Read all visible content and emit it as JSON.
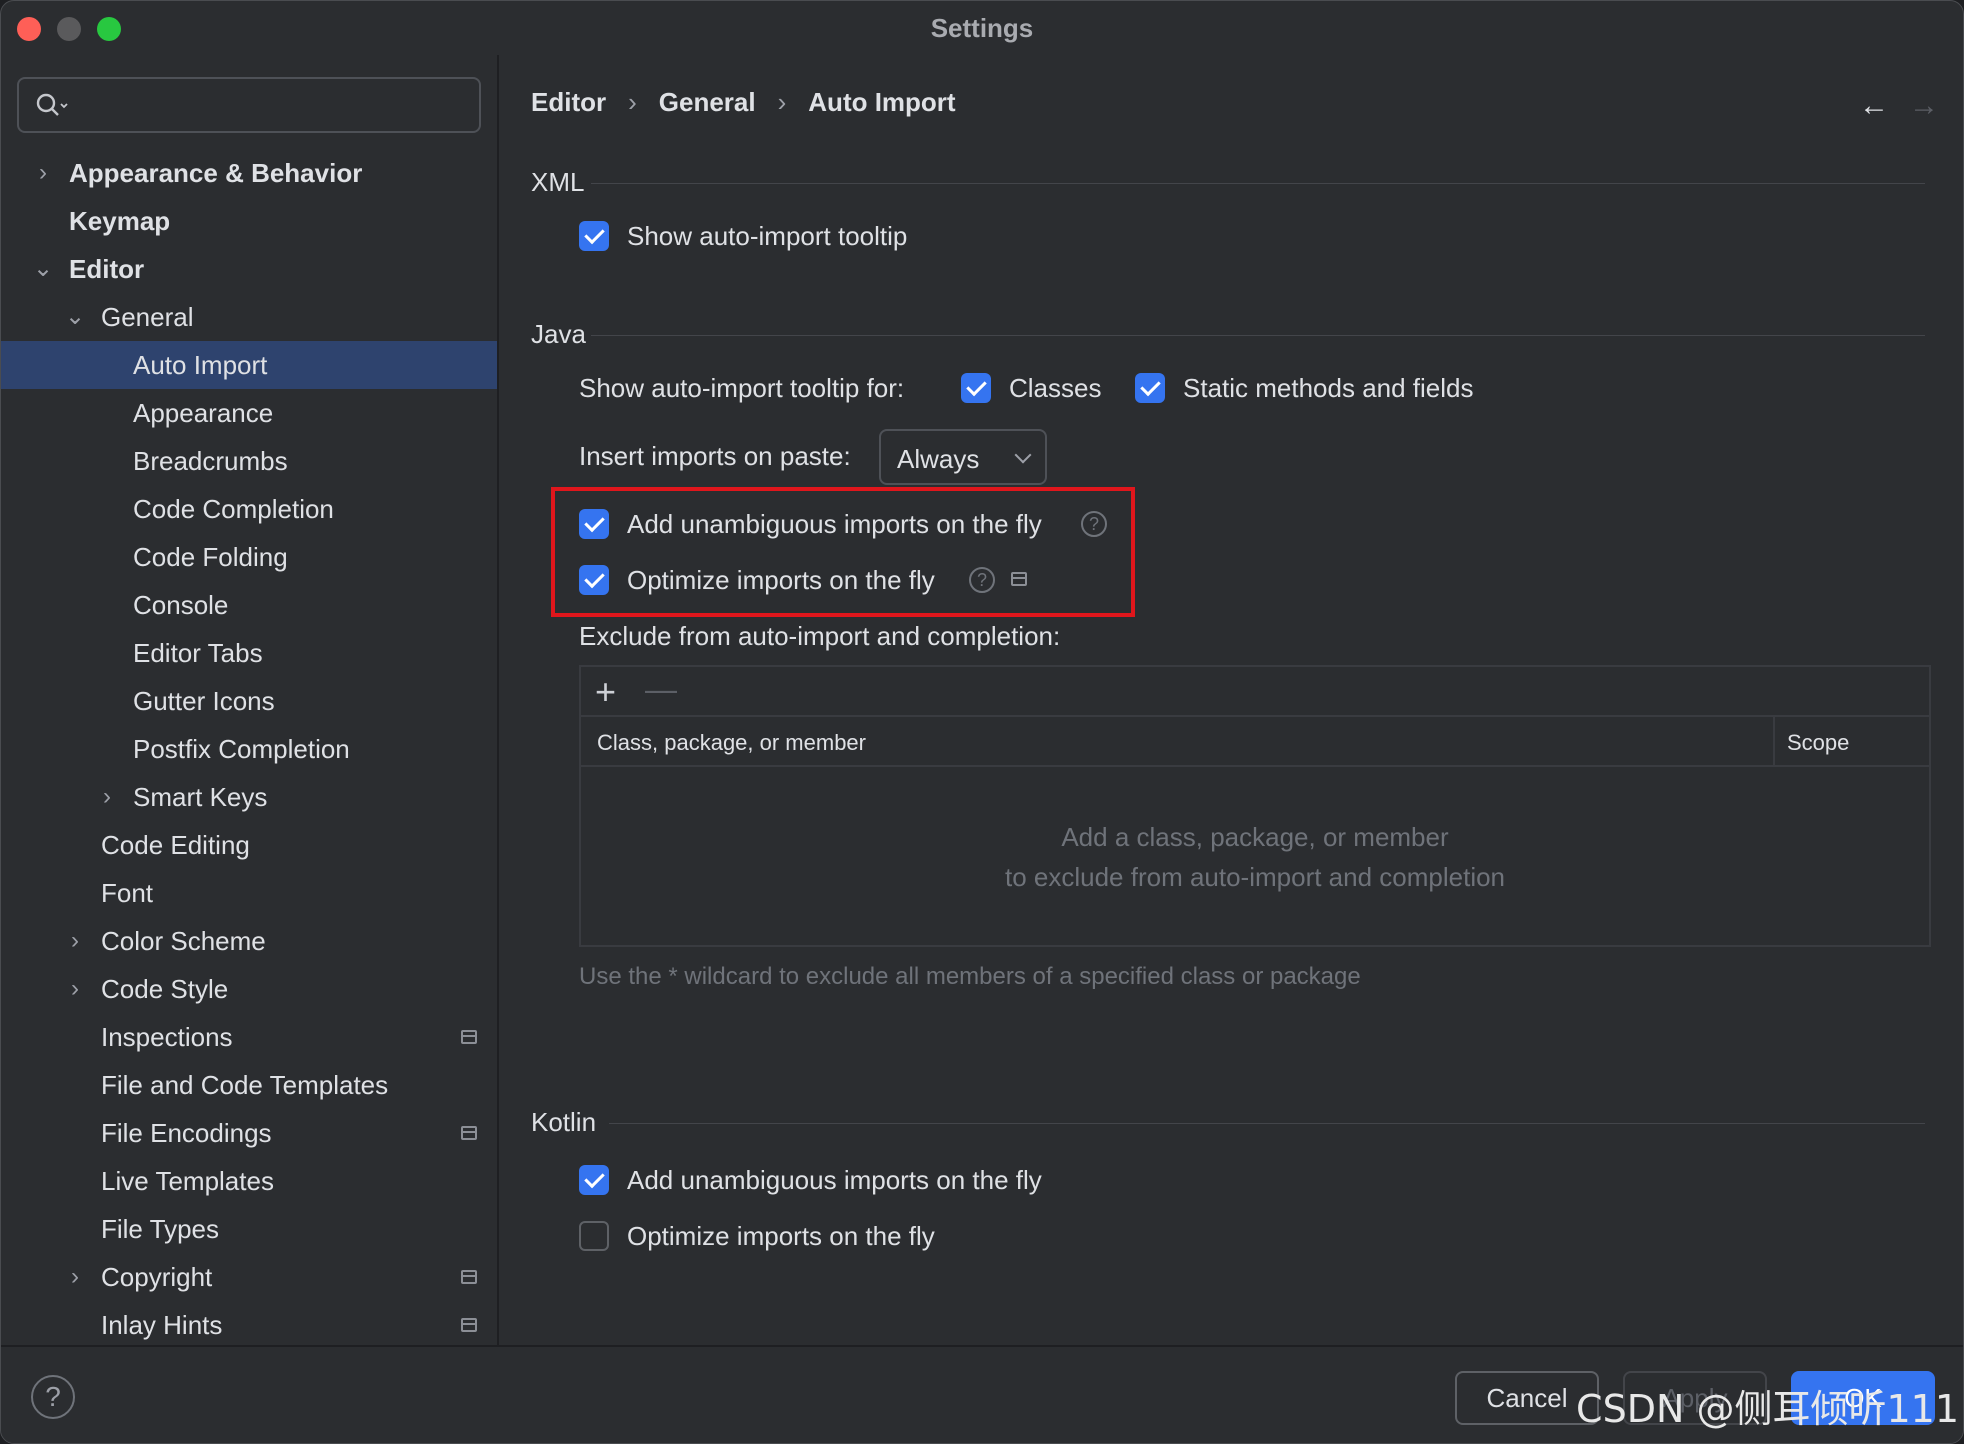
{
  "window": {
    "title": "Settings"
  },
  "search": {
    "value": ""
  },
  "sidebar": {
    "items": [
      {
        "label": "Appearance & Behavior"
      },
      {
        "label": "Keymap"
      },
      {
        "label": "Editor"
      },
      {
        "label": "General"
      },
      {
        "label": "Auto Import"
      },
      {
        "label": "Appearance"
      },
      {
        "label": "Breadcrumbs"
      },
      {
        "label": "Code Completion"
      },
      {
        "label": "Code Folding"
      },
      {
        "label": "Console"
      },
      {
        "label": "Editor Tabs"
      },
      {
        "label": "Gutter Icons"
      },
      {
        "label": "Postfix Completion"
      },
      {
        "label": "Smart Keys"
      },
      {
        "label": "Code Editing"
      },
      {
        "label": "Font"
      },
      {
        "label": "Color Scheme"
      },
      {
        "label": "Code Style"
      },
      {
        "label": "Inspections"
      },
      {
        "label": "File and Code Templates"
      },
      {
        "label": "File Encodings"
      },
      {
        "label": "Live Templates"
      },
      {
        "label": "File Types"
      },
      {
        "label": "Copyright"
      },
      {
        "label": "Inlay Hints"
      }
    ]
  },
  "breadcrumb": {
    "items": [
      "Editor",
      "General",
      "Auto Import"
    ],
    "separator": "›"
  },
  "nav": {
    "back": "←",
    "forward": "→"
  },
  "xml": {
    "title": "XML",
    "show_tooltip": {
      "label": "Show auto-import tooltip",
      "checked": true
    }
  },
  "java": {
    "title": "Java",
    "tooltip_for_label": "Show auto-import tooltip for:",
    "classes": {
      "label": "Classes",
      "checked": true
    },
    "static": {
      "label": "Static methods and fields",
      "checked": true
    },
    "insert_label": "Insert imports on paste:",
    "insert_value": "Always",
    "add_unambiguous": {
      "label": "Add unambiguous imports on the fly",
      "checked": true
    },
    "optimize": {
      "label": "Optimize imports on the fly",
      "checked": true
    },
    "exclude_label": "Exclude from auto-import and completion:",
    "table": {
      "add": "+",
      "remove": "—",
      "col_class": "Class, package, or member",
      "col_scope": "Scope",
      "empty_line1": "Add a class, package, or member",
      "empty_line2": "to exclude from auto-import and completion"
    },
    "hint": "Use the * wildcard to exclude all members of a specified class or package"
  },
  "kotlin": {
    "title": "Kotlin",
    "add_unambiguous": {
      "label": "Add unambiguous imports on the fly",
      "checked": true
    },
    "optimize": {
      "label": "Optimize imports on the fly",
      "checked": false
    }
  },
  "footer": {
    "help": "?",
    "cancel": "Cancel",
    "apply": "Apply",
    "ok": "OK"
  },
  "watermark": "CSDN @侧耳倾听111",
  "colors": {
    "accent": "#3574f0",
    "selection": "#2e436e",
    "highlight_border": "#e0161c"
  }
}
